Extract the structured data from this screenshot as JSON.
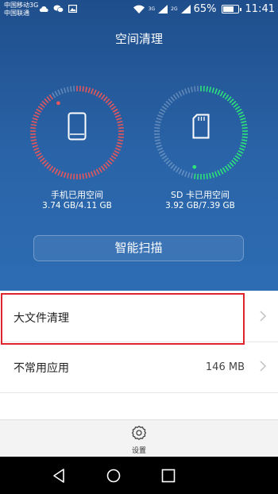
{
  "status_bar": {
    "carrier_1": "中国移动3G",
    "carrier_2": "中国联通",
    "net_1": "3G",
    "net_2": "2G",
    "battery": "65%",
    "battery_level": 0.65,
    "time": "11:41"
  },
  "header": {
    "title": "空间清理"
  },
  "gauges": {
    "phone": {
      "label": "手机已用空间",
      "value": "3.74 GB/4.11 GB",
      "fraction": 0.91,
      "color": "#e5575b"
    },
    "sd": {
      "label": "SD 卡已用空间",
      "value": "3.92 GB/7.39 GB",
      "fraction": 0.53,
      "color": "#2ee37a"
    }
  },
  "scan_button": {
    "label": "智能扫描"
  },
  "list": [
    {
      "label": "大文件清理",
      "value": ""
    },
    {
      "label": "不常用应用",
      "value": "146 MB"
    }
  ],
  "bottom": {
    "settings_label": "设置"
  },
  "colors": {
    "accent_blue": "#2a64a8",
    "highlight_red": "#e0242b"
  }
}
